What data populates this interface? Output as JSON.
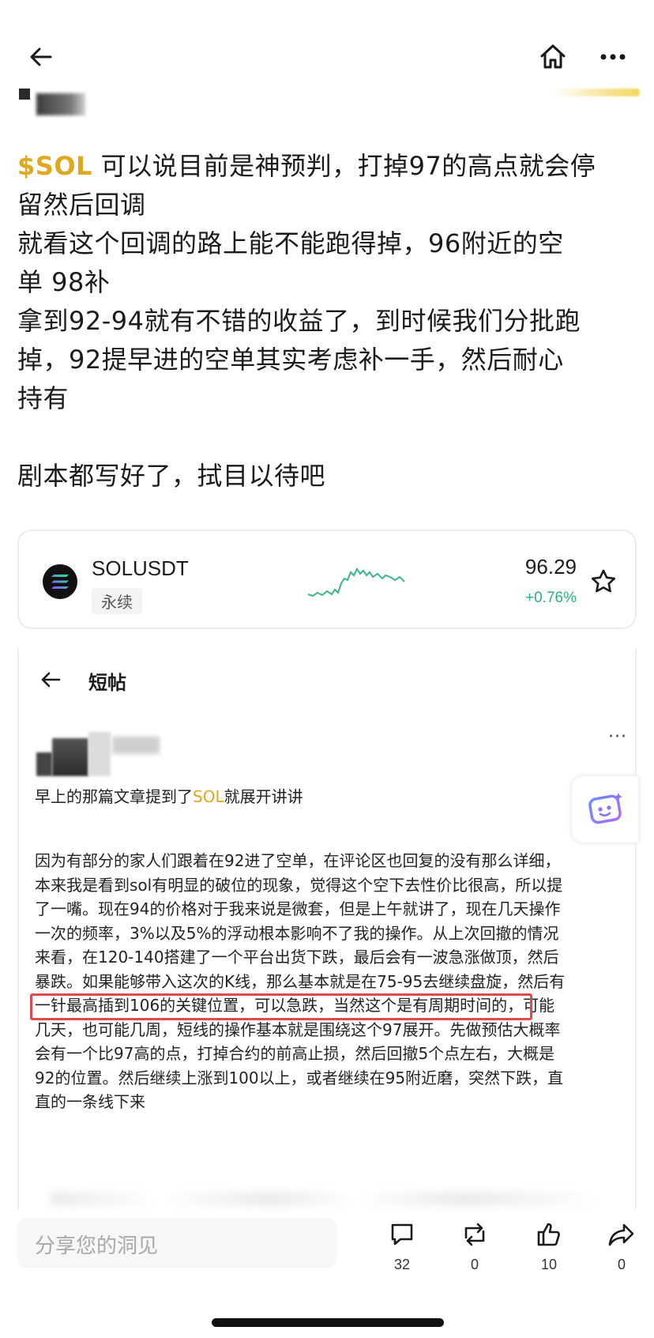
{
  "topbar": {
    "back_icon": "arrow-left-icon",
    "home_icon": "home-icon",
    "more_icon": "more-horizontal-icon"
  },
  "post": {
    "ticker": "$SOL",
    "lines": [
      "可以说目前是神预判，打掉97的高点就会停",
      "留然后回调",
      "就看这个回调的路上能不能跑得掉，96附近的空",
      "单 98补",
      "拿到92-94就有不错的收益了，到时候我们分批跑",
      "掉，92提早进的空单其实考虑补一手，然后耐心",
      "持有"
    ],
    "closing": "剧本都写好了，拭目以待吧"
  },
  "ticker_card": {
    "symbol": "SOLUSDT",
    "tag": "永续",
    "price": "96.29",
    "change": "+0.76%",
    "change_color": "#2bb37a",
    "star_icon": "star-outline-icon"
  },
  "embedded": {
    "title": "短帖",
    "intro_prefix": "早上的那篇文章提到了",
    "intro_sol": "SOL",
    "intro_suffix": "就展开讲讲",
    "body_lines": [
      "因为有部分的家人们跟着在92进了空单，在评论区也回复的没有那么详细，",
      "本来我是看到sol有明显的破位的现象，觉得这个空下去性价比很高，所以提",
      "了一嘴。现在94的价格对于我来说是微套，但是上午就讲了，现在几天操作",
      "一次的频率，3%以及5%的浮动根本影响不了我的操作。从上次回撤的情况",
      "来看，在120-140搭建了一个平台出货下跌，最后会有一波急涨做顶，然后",
      "暴跌。如果能够带入这次的K线，那么基本就是在75-95去继续盘旋，然后有",
      "一针最高插到106的关键位置，可以急跌，当然这个是有周期时间的，可能",
      "几天，也可能几周，短线的操作基本就是围绕这个97展开。先做预估大概率",
      "会有一个比97高的点，打掉合约的前高止损，然后回撤5个点左右，大概是",
      "92的位置。然后继续上涨到100以上，或者继续在95附近磨，突然下跌，直",
      "直的一条线下来"
    ],
    "highlight_color": "#e04a4a"
  },
  "bottom_bar": {
    "placeholder": "分享您的洞见",
    "comments": "32",
    "reposts": "0",
    "likes": "10",
    "shares": "0"
  }
}
